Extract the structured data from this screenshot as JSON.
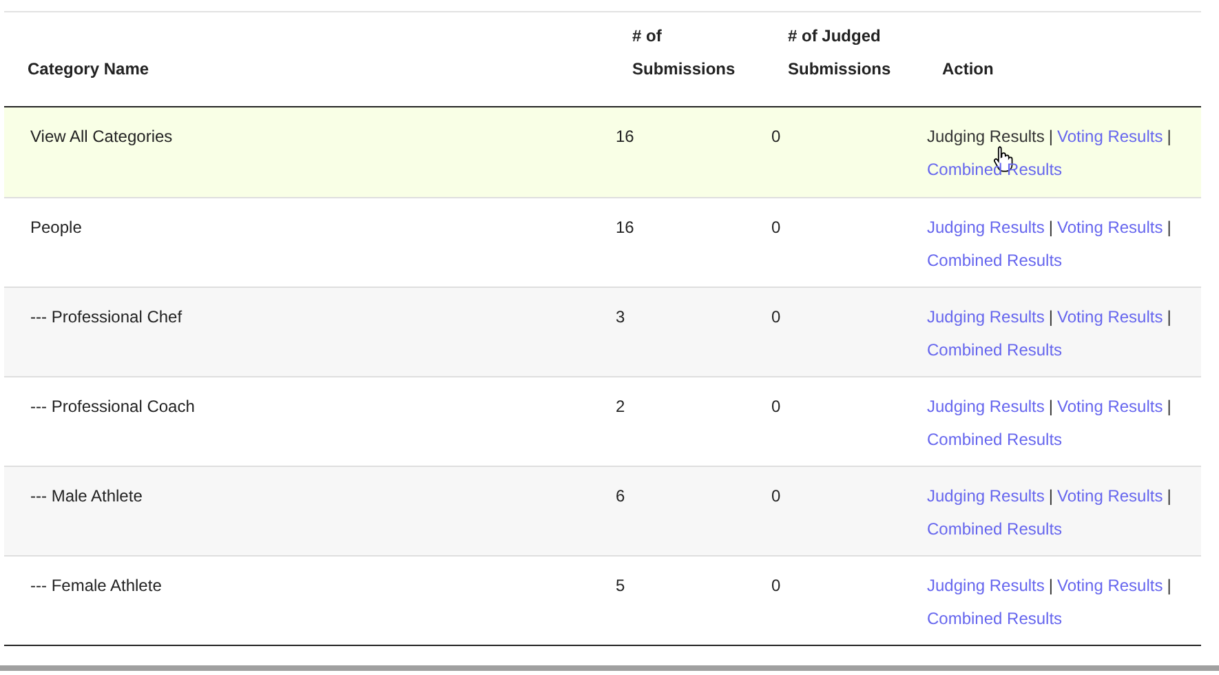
{
  "table": {
    "columns": [
      {
        "label": "Category Name"
      },
      {
        "label": "# of Submissions"
      },
      {
        "label": "# of Judged Submissions"
      },
      {
        "label": "Action"
      }
    ],
    "rows": [
      {
        "name": "View All Categories",
        "submissions": "16",
        "judged": "0",
        "hovered": true,
        "links": [
          {
            "label": "Judging Results",
            "hovered": true
          },
          {
            "label": "Voting Results",
            "hovered": false
          },
          {
            "label": "Combined Results",
            "hovered": false
          }
        ]
      },
      {
        "name": "People",
        "submissions": "16",
        "judged": "0",
        "hovered": false,
        "links": [
          {
            "label": "Judging Results",
            "hovered": false
          },
          {
            "label": "Voting Results",
            "hovered": false
          },
          {
            "label": "Combined Results",
            "hovered": false
          }
        ]
      },
      {
        "name": "--- Professional Chef",
        "submissions": "3",
        "judged": "0",
        "hovered": false,
        "links": [
          {
            "label": "Judging Results",
            "hovered": false
          },
          {
            "label": "Voting Results",
            "hovered": false
          },
          {
            "label": "Combined Results",
            "hovered": false
          }
        ]
      },
      {
        "name": "--- Professional Coach",
        "submissions": "2",
        "judged": "0",
        "hovered": false,
        "links": [
          {
            "label": "Judging Results",
            "hovered": false
          },
          {
            "label": "Voting Results",
            "hovered": false
          },
          {
            "label": "Combined Results",
            "hovered": false
          }
        ]
      },
      {
        "name": "--- Male Athlete",
        "submissions": "6",
        "judged": "0",
        "hovered": false,
        "links": [
          {
            "label": "Judging Results",
            "hovered": false
          },
          {
            "label": "Voting Results",
            "hovered": false
          },
          {
            "label": "Combined Results",
            "hovered": false
          }
        ]
      },
      {
        "name": "--- Female Athlete",
        "submissions": "5",
        "judged": "0",
        "hovered": false,
        "links": [
          {
            "label": "Judging Results",
            "hovered": false
          },
          {
            "label": "Voting Results",
            "hovered": false
          },
          {
            "label": "Combined Results",
            "hovered": false
          }
        ]
      }
    ],
    "separator": "|"
  }
}
